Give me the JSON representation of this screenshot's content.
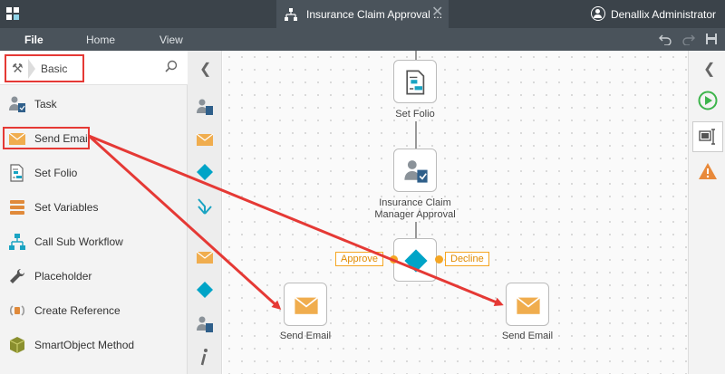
{
  "titlebar": {
    "doc_tab_title": "Insurance Claim Approval ...",
    "close_glyph": "✕",
    "user_name": "Denallix Administrator"
  },
  "menu": {
    "file": "File",
    "home": "Home",
    "view": "View"
  },
  "toolbox": {
    "category": "Basic",
    "items": [
      {
        "label": "Task",
        "icon": "task-icon"
      },
      {
        "label": "Send Email",
        "icon": "envelope-icon"
      },
      {
        "label": "Set Folio",
        "icon": "set-folio-icon"
      },
      {
        "label": "Set Variables",
        "icon": "stack-icon"
      },
      {
        "label": "Call Sub Workflow",
        "icon": "hierarchy-icon"
      },
      {
        "label": "Placeholder",
        "icon": "wrench-icon"
      },
      {
        "label": "Create Reference",
        "icon": "reference-icon"
      },
      {
        "label": "SmartObject Method",
        "icon": "cube-icon"
      }
    ]
  },
  "canvas": {
    "nodes": {
      "set_folio": "Set Folio",
      "manager_approval_line1": "Insurance Claim",
      "manager_approval_line2": "Manager Approval",
      "send_email_left": "Send Email",
      "send_email_right": "Send Email"
    },
    "outcomes": {
      "approve": "Approve",
      "decline": "Decline"
    }
  },
  "colors": {
    "topbar": "#3b434a",
    "menubar": "#4a535b",
    "highlight": "#e53935",
    "envelope": "#f0ad4e",
    "decision": "#00a4c7",
    "outcome": "#f5a623",
    "run": "#3cb44b",
    "warning": "#e8893a"
  }
}
